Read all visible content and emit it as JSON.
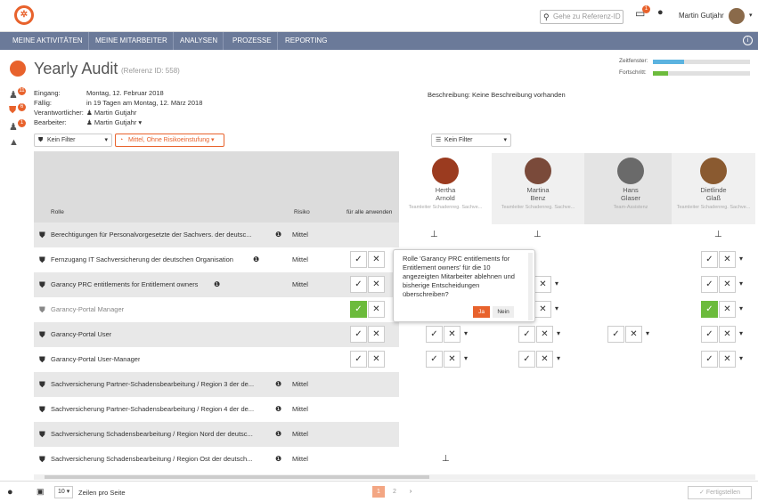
{
  "header": {
    "search_placeholder": "Gehe zu Referenz-ID",
    "notify_count": "1",
    "user_name": "Martin Gutjahr"
  },
  "nav": {
    "items": [
      "MEINE AKTIVITÄTEN",
      "MEINE MITARBEITER",
      "ANALYSEN",
      "PROZESSE",
      "REPORTING"
    ]
  },
  "sidebar": {
    "badges": [
      "11",
      "6",
      "1"
    ]
  },
  "page": {
    "title": "Yearly Audit",
    "refid": "(Referenz ID: 558)"
  },
  "meta": {
    "eingang_label": "Eingang:",
    "eingang_value": "Montag, 12. Februar 2018",
    "faellig_label": "Fällig:",
    "faellig_value": "in 19 Tagen am Montag, 12. März 2018",
    "verantw_label": "Verantwortlicher:",
    "verantw_value": "Martin Gutjahr",
    "bearbeiter_label": "Bearbeiter:",
    "bearbeiter_value": "Martin Gutjahr",
    "beschreibung": "Beschreibung:  Keine Beschreibung vorhanden"
  },
  "progress": {
    "zeitfenster_label": "Zeitfenster:",
    "zeitfenster_value": 0.32,
    "fortschritt_label": "Fortschritt:",
    "fortschritt_value": 0.16,
    "zeit_color": "#5bb3e0",
    "fort_color": "#6cbb3c"
  },
  "filters": {
    "kein_filter": "Kein Filter",
    "risk_filter": "Mittel, Ohne Risikoeinstufung",
    "kein_filter2": "Kein Filter"
  },
  "table": {
    "col_rolle": "Rolle",
    "col_risiko": "Risiko",
    "col_alle": "für alle anwenden"
  },
  "people": [
    {
      "first": "Hertha",
      "last": "Arnold",
      "role": "Teamleiter Schadenreg. Sachve..."
    },
    {
      "first": "Martina",
      "last": "Benz",
      "role": "Teamleiter Schadenreg. Sachve..."
    },
    {
      "first": "Hans",
      "last": "Glaser",
      "role": "Team-Assistenz"
    },
    {
      "first": "Dietlinde",
      "last": "Glaß",
      "role": "Teamleiter Schadenreg. Sachve..."
    }
  ],
  "rows": [
    {
      "name": "Berechtigungen für Personalvorgesetzte der Sachvers. der deutsc...",
      "risk": "Mittel"
    },
    {
      "name": "Fernzugang IT Sachversicherung der deutschen Organisation",
      "risk": "Mittel"
    },
    {
      "name": "Garancy PRC entitlements for Entitlement owners",
      "risk": "Mittel"
    },
    {
      "name": "Garancy-Portal Manager",
      "risk": ""
    },
    {
      "name": "Garancy-Portal User",
      "risk": ""
    },
    {
      "name": "Garancy-Portal User-Manager",
      "risk": ""
    },
    {
      "name": "Sachversicherung Partner-Schadensbearbeitung / Region 3 der de...",
      "risk": "Mittel"
    },
    {
      "name": "Sachversicherung Partner-Schadensbearbeitung / Region 4 der de...",
      "risk": "Mittel"
    },
    {
      "name": "Sachversicherung Schadensbearbeitung / Region Nord der deutsc...",
      "risk": "Mittel"
    },
    {
      "name": "Sachversicherung Schadensbearbeitung / Region Ost der deutsch...",
      "risk": "Mittel"
    }
  ],
  "popup": {
    "text": "Rolle 'Garancy PRC entitlements for Entitlement owners' für die 10 angezeigten Mitarbeiter ablehnen und bisherige Entscheidungen überschreiben?",
    "yes": "Ja",
    "no": "Nein"
  },
  "footer": {
    "page_size": "10",
    "page_size_label": "Zeilen pro Seite",
    "page1": "1",
    "page2": "2",
    "finish": "Fertigstellen"
  }
}
